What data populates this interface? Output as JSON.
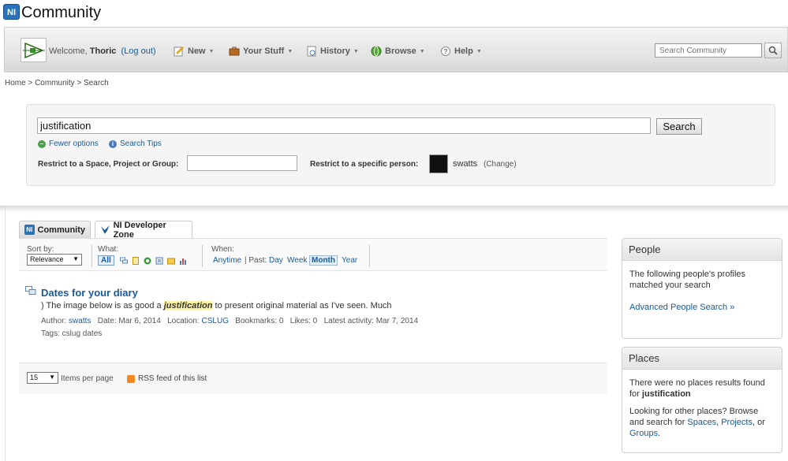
{
  "header": {
    "logo_text": "NI",
    "site_title": "Community"
  },
  "navbar": {
    "welcome_prefix": "Welcome,",
    "username": "Thoric",
    "logout": "(Log out)",
    "items": [
      {
        "label": "New",
        "icon": "pencil-icon"
      },
      {
        "label": "Your Stuff",
        "icon": "briefcase-icon"
      },
      {
        "label": "History",
        "icon": "history-icon"
      },
      {
        "label": "Browse",
        "icon": "globe-icon"
      },
      {
        "label": "Help",
        "icon": "help-icon"
      }
    ],
    "search_placeholder": "Search Community"
  },
  "breadcrumb": "Home > Community > Search",
  "search": {
    "query": "justification",
    "button": "Search",
    "fewer_options": "Fewer options",
    "search_tips": "Search Tips",
    "restrict_space_label": "Restrict to a Space, Project or Group:",
    "restrict_person_label": "Restrict to a specific person:",
    "person_name": "swatts",
    "person_change": "(Change)"
  },
  "tabs": [
    {
      "label": "Community"
    },
    {
      "label": "NI Developer Zone"
    }
  ],
  "filters": {
    "sort_label": "Sort by:",
    "sort_value": "Relevance",
    "what_label": "What:",
    "what_all": "All",
    "when_label": "When:",
    "when_anytime": "Anytime",
    "when_past": "| Past:",
    "when_day": "Day",
    "when_week": "Week",
    "when_month": "Month",
    "when_year": "Year"
  },
  "result": {
    "title": "Dates for your diary",
    "snippet_before": ") The image below is as good a ",
    "snippet_highlight": "justification",
    "snippet_after": " to present original material as I've seen. Much",
    "author_label": "Author:",
    "author": "swatts",
    "date": "Date: Mar 6, 2014",
    "location_label": "Location:",
    "location": "CSLUG",
    "bookmarks": "Bookmarks: 0",
    "likes": "Likes: 0",
    "latest": "Latest activity: Mar 7, 2014",
    "tags": "Tags: cslug dates"
  },
  "pager": {
    "per_page_value": "15",
    "per_page_label": "Items per page",
    "rss": "RSS feed of this list"
  },
  "people_box": {
    "title": "People",
    "text": "The following people's profiles matched your search",
    "link": "Advanced People Search »"
  },
  "places_box": {
    "title": "Places",
    "text_prefix": "There were no places results found for",
    "text_term": "justification",
    "text2_prefix": "Looking for other places? Browse and search for",
    "link_spaces": "Spaces",
    "sep1": ",",
    "link_projects": "Projects",
    "sep2": ", or",
    "link_groups": "Groups",
    "end": "."
  }
}
